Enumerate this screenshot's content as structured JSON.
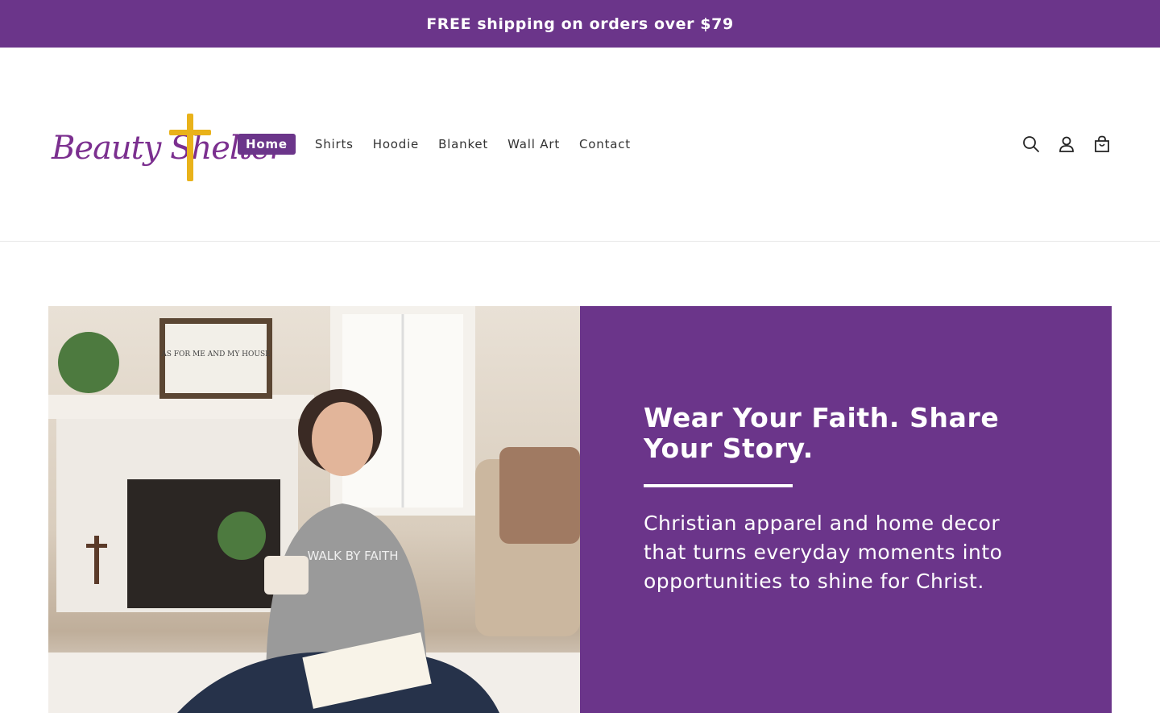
{
  "announcement": {
    "text": "FREE shipping on orders over $79"
  },
  "brand": {
    "logo_text": "Beauty Shelter",
    "accent": "#6b358a",
    "cross_color": "#e9b21a"
  },
  "nav": {
    "items": [
      {
        "label": "Home",
        "active": true
      },
      {
        "label": "Shirts"
      },
      {
        "label": "Hoodie"
      },
      {
        "label": "Blanket"
      },
      {
        "label": "Wall Art"
      },
      {
        "label": "Contact"
      }
    ]
  },
  "header_icons": [
    "search-icon",
    "account-icon",
    "cart-icon"
  ],
  "hero": {
    "image_alt": "Woman in gray hoodie holding a mug with an open Bible by a fireplace",
    "hoodie_text": "WALK BY FAITH",
    "sign_text": "AS FOR ME AND my House WE WILL SERVE the Lord",
    "title": "Wear Your Faith. Share Your Story.",
    "subtitle": "Christian apparel and home decor that turns everyday moments into opportunities to shine for Christ."
  }
}
